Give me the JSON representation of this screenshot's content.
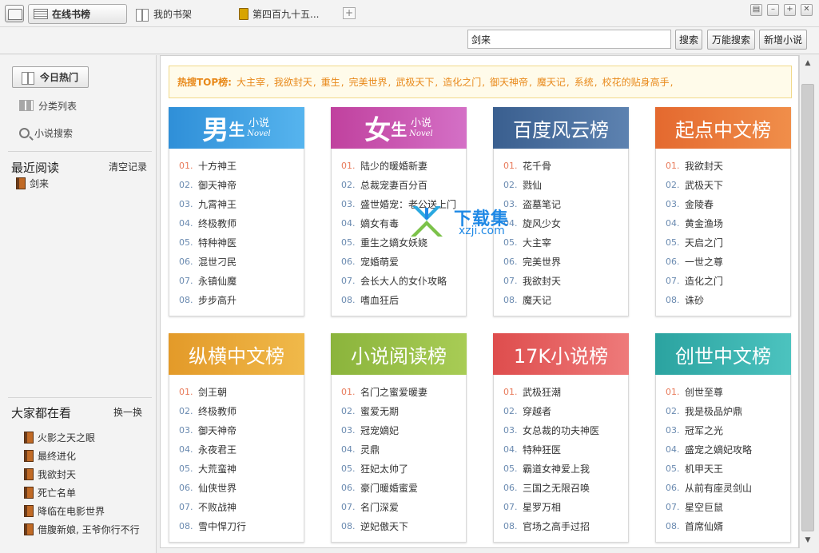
{
  "tabs": [
    {
      "label": "在线书榜",
      "icon": "list-icon",
      "active": true
    },
    {
      "label": "我的书架",
      "icon": "bookshelf-icon",
      "active": false
    },
    {
      "label": "第四百九十五...",
      "icon": "book-icon",
      "active": false
    }
  ],
  "search": {
    "value": "剑来",
    "button": "搜索",
    "universal_button": "万能搜索",
    "add_button": "新增小说"
  },
  "sidebar": {
    "today_hot": "今日热门",
    "category_list": "分类列表",
    "novel_search": "小说搜索",
    "recent_title": "最近阅读",
    "clear_records": "清空记录",
    "recent_items": [
      "剑来"
    ],
    "popular_title": "大家都在看",
    "refresh": "换一换",
    "popular_items": [
      "火影之天之眼",
      "最终进化",
      "我欲封天",
      "死亡名单",
      "降临在电影世界",
      "借腹新娘, 王爷你行不行"
    ]
  },
  "hot_search": {
    "label": "热搜TOP榜:",
    "items": [
      "大主宰",
      "我欲封天",
      "重生",
      "完美世界",
      "武极天下",
      "造化之门",
      "御天神帝",
      "魔天记",
      "系统",
      "校花的贴身高手"
    ]
  },
  "cards": [
    {
      "title": "男",
      "title_small": "生",
      "sub_cn": "小说",
      "sub_en": "Novel",
      "style": "big",
      "color": "#2f8fd8",
      "color2": "#56b4ee",
      "items": [
        "十方神王",
        "御天神帝",
        "九霄神王",
        "终极教师",
        "特种神医",
        "混世刁民",
        "永镇仙魔",
        "步步高升"
      ]
    },
    {
      "title": "女",
      "title_small": "生",
      "sub_cn": "小说",
      "sub_en": "Novel",
      "style": "big",
      "color": "#c0419e",
      "color2": "#d470c6",
      "items": [
        "陆少的暖婚新妻",
        "总裁宠妻百分百",
        "盛世婚宠：老公送上门",
        "嫡女有毒",
        "重生之嫡女妖娆",
        "宠婚萌爱",
        "会长大人的女仆攻略",
        "嗜血狂后"
      ]
    },
    {
      "title": "百度风云榜",
      "style": "text",
      "color": "#3a5f8f",
      "color2": "#5d82b0",
      "items": [
        "花千骨",
        "戮仙",
        "盗墓笔记",
        "旋风少女",
        "大主宰",
        "完美世界",
        "我欲封天",
        "魔天记"
      ]
    },
    {
      "title": "起点中文榜",
      "style": "text",
      "color": "#e4692f",
      "color2": "#f08e4a",
      "items": [
        "我欲封天",
        "武极天下",
        "金陵春",
        "黄金渔场",
        "天启之门",
        "一世之尊",
        "造化之门",
        "诛砂"
      ]
    },
    {
      "title": "纵横中文榜",
      "style": "text",
      "color": "#e39a29",
      "color2": "#f0b94a",
      "items": [
        "剑王朝",
        "终极教师",
        "御天神帝",
        "永夜君王",
        "大荒蛮神",
        "仙侠世界",
        "不败战神",
        "雪中悍刀行"
      ]
    },
    {
      "title": "小说阅读榜",
      "style": "text",
      "color": "#8bb43c",
      "color2": "#a8cc55",
      "items": [
        "名门之蜜爱暖妻",
        "蜜爱无期",
        "冠宠嫡妃",
        "灵鼎",
        "狂妃太帅了",
        "豪门暖婚蜜爱",
        "名门深爱",
        "逆妃傲天下"
      ]
    },
    {
      "title": "17K小说榜",
      "style": "text",
      "color": "#de4d4d",
      "color2": "#ee7a7a",
      "items": [
        "武极狂潮",
        "穿越者",
        "女总裁的功夫神医",
        "特种狂医",
        "霸道女神爱上我",
        "三国之无限召唤",
        "星罗万相",
        "官场之高手过招"
      ]
    },
    {
      "title": "创世中文榜",
      "style": "text",
      "color": "#2ba3a0",
      "color2": "#4cc3bf",
      "items": [
        "创世至尊",
        "我是极品炉鼎",
        "冠军之光",
        "盛宠之嫡妃攻略",
        "机甲天王",
        "从前有座灵剑山",
        "星空巨鼠",
        "首席仙婿"
      ]
    }
  ],
  "watermark": {
    "title": "下载集",
    "url": "xzji.com"
  }
}
